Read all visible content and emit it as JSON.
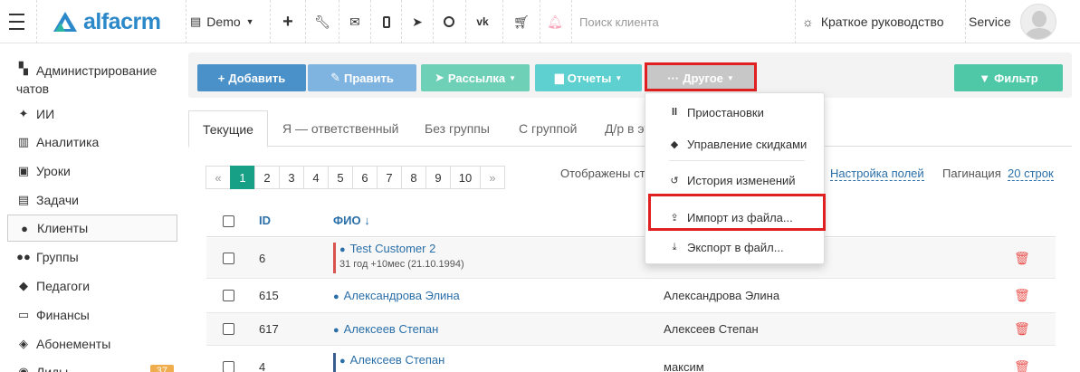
{
  "header": {
    "logo_text": "alfacrm",
    "branch": "Demo",
    "search_placeholder": "Поиск клиента",
    "guide_label": "Краткое руководство",
    "user_label": "Service"
  },
  "sidebar": {
    "items": [
      {
        "label": "Администрирование чатов",
        "icon": "chat-admin-icon"
      },
      {
        "label": "ИИ",
        "icon": "sparkle-icon"
      },
      {
        "label": "Аналитика",
        "icon": "map-icon"
      },
      {
        "label": "Уроки",
        "icon": "calendar-icon"
      },
      {
        "label": "Задачи",
        "icon": "clipboard-icon"
      },
      {
        "label": "Клиенты",
        "icon": "user-icon"
      },
      {
        "label": "Группы",
        "icon": "users-icon"
      },
      {
        "label": "Педагоги",
        "icon": "graduation-icon"
      },
      {
        "label": "Финансы",
        "icon": "money-icon"
      },
      {
        "label": "Абонементы",
        "icon": "tag-icon"
      },
      {
        "label": "Лиды",
        "icon": "lead-icon",
        "badge": "37"
      }
    ]
  },
  "toolbar": {
    "add_label": "Добавить",
    "edit_label": "Править",
    "mail_label": "Рассылка",
    "reports_label": "Отчеты",
    "other_label": "Другое",
    "filter_label": "Фильтр"
  },
  "tabs": [
    "Текущие",
    "Я — ответственный",
    "Без группы",
    "С группой",
    "Д/р в эт"
  ],
  "pager": {
    "prev": "«",
    "pages": [
      "1",
      "2",
      "3",
      "4",
      "5",
      "6",
      "7",
      "8",
      "9",
      "10"
    ],
    "next": "»",
    "active": "1"
  },
  "list_info": {
    "shown": "Отображены ст",
    "fields_link": "Настройка полей",
    "pagination_label": "Пагинация",
    "pagination_value": "20 строк"
  },
  "table": {
    "columns": {
      "id": "ID",
      "name": "ФИО"
    },
    "sort_arrow": "↓",
    "rows": [
      {
        "id": "6",
        "name": "Test Customer 2",
        "sub": "31 год +10мес (21.10.1994)",
        "col3": "",
        "mark_color": "#d9534f"
      },
      {
        "id": "615",
        "name": "Александрова Элина",
        "sub": "",
        "col3": "Александрова Элина",
        "mark_color": ""
      },
      {
        "id": "617",
        "name": "Алексеев Степан",
        "sub": "",
        "col3": "Алексеев Степан",
        "mark_color": ""
      },
      {
        "id": "4",
        "name": "Алексеев Степан",
        "sub": "",
        "col3": "максим",
        "mark_color": "#3a5f8f"
      }
    ]
  },
  "dropdown": {
    "items": [
      {
        "label": "Приостановки",
        "icon": "pause-icon"
      },
      {
        "label": "Управление скидками",
        "icon": "tag-icon"
      },
      {
        "label": "История изменений",
        "icon": "history-icon"
      },
      {
        "label": "Импорт из файла...",
        "icon": "upload-icon"
      },
      {
        "label": "Экспорт в файл...",
        "icon": "download-icon"
      }
    ]
  }
}
